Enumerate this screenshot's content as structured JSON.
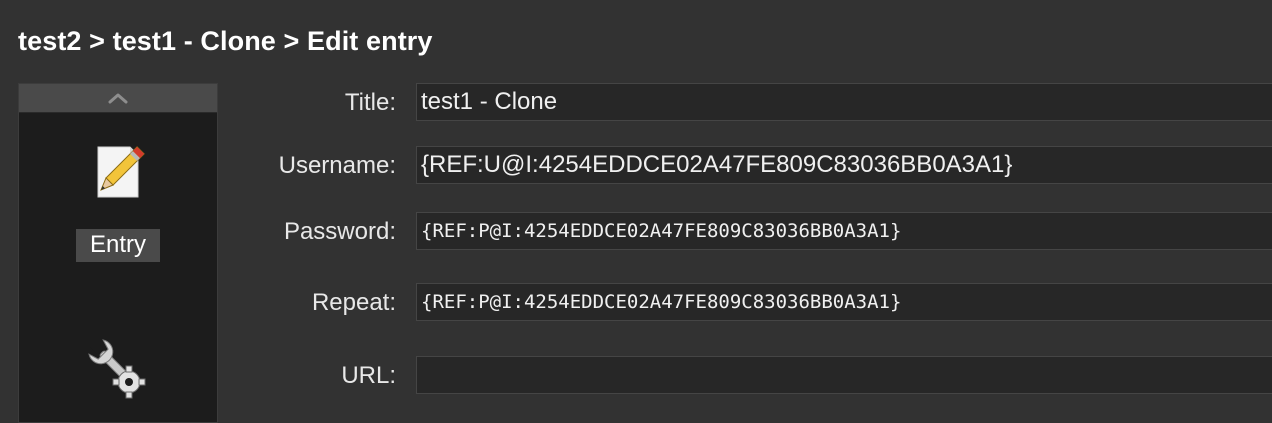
{
  "header": {
    "breadcrumb": "test2 > test1 - Clone > Edit entry"
  },
  "sidebar": {
    "scroll_up_icon": "chevron-up-icon",
    "items": [
      {
        "label": "Entry",
        "icon": "pencil-icon",
        "selected": true
      },
      {
        "label": "",
        "icon": "wrench-gear-icon",
        "selected": false
      }
    ]
  },
  "form": {
    "title": {
      "label": "Title:",
      "value": "test1 - Clone"
    },
    "username": {
      "label": "Username:",
      "value": "{REF:U@I:4254EDDCE02A47FE809C83036BB0A3A1}"
    },
    "password": {
      "label": "Password:",
      "value": "{REF:P@I:4254EDDCE02A47FE809C83036BB0A3A1}"
    },
    "repeat": {
      "label": "Repeat:",
      "value": "{REF:P@I:4254EDDCE02A47FE809C83036BB0A3A1}"
    },
    "url": {
      "label": "URL:",
      "value": ""
    }
  },
  "colors": {
    "background": "#323232",
    "sidebar": "#1c1c1c",
    "selected_label": "#4a4a4a",
    "input": "#272727"
  }
}
